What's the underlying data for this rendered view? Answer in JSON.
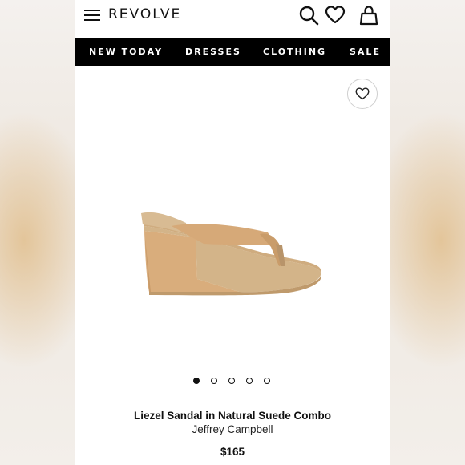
{
  "header": {
    "logo": "REVOLVE",
    "icons": [
      "menu-icon",
      "search-icon",
      "heart-icon",
      "bag-icon"
    ]
  },
  "nav": {
    "items": [
      {
        "label": "NEW TODAY"
      },
      {
        "label": "DRESSES"
      },
      {
        "label": "CLOTHING"
      },
      {
        "label": "SALE"
      }
    ]
  },
  "product": {
    "title": "Liezel Sandal in Natural Suede Combo",
    "brand": "Jeffrey Campbell",
    "price": "$165",
    "image_count": 5,
    "active_image": 1
  },
  "colors": {
    "nav_bg": "#000000",
    "text": "#111111",
    "suede": "#d9ad7c",
    "leather": "#d6b78e"
  }
}
